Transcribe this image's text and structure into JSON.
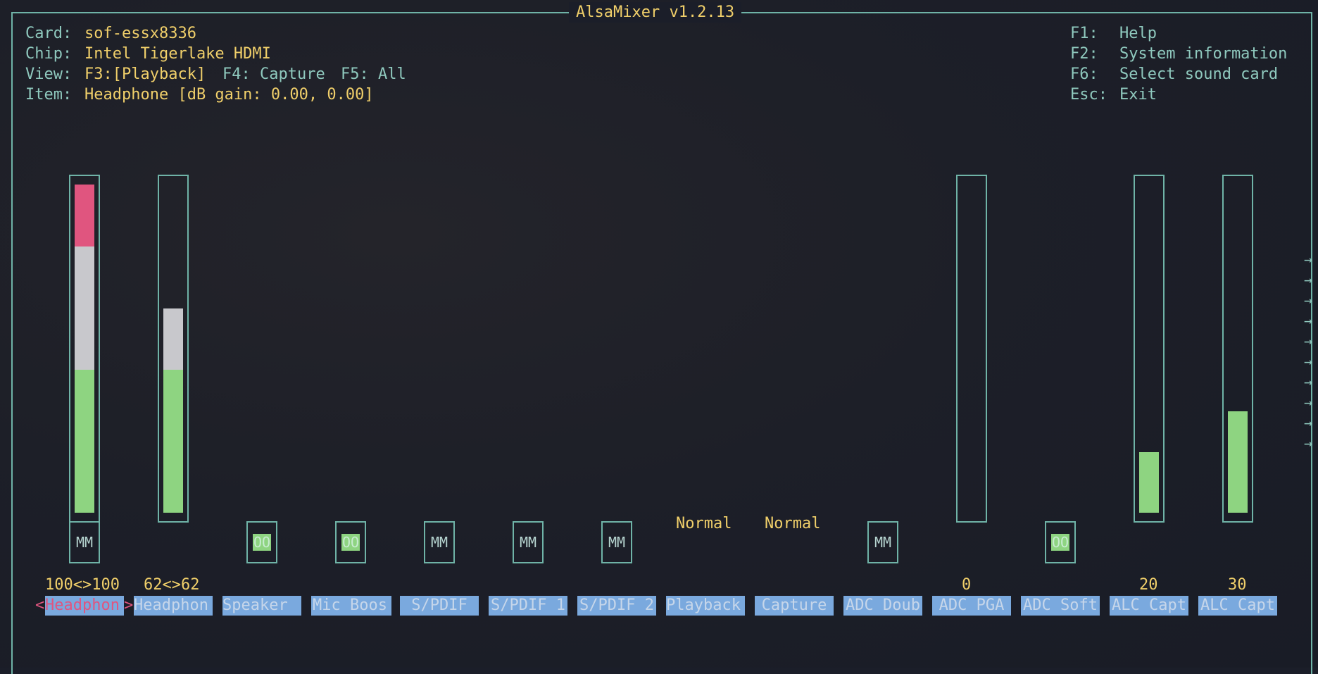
{
  "title": "AlsaMixer v1.2.13",
  "info": {
    "card_label": "Card:",
    "card": "sof-essx8336",
    "chip_label": "Chip:",
    "chip": "Intel Tigerlake HDMI",
    "view_label": "View:",
    "view_f3": "F3:[Playback]",
    "view_f4": "F4: Capture",
    "view_f5": "F5: All",
    "item_label": "Item:",
    "item": "Headphone [dB gain: 0.00, 0.00]"
  },
  "keys": [
    {
      "key": "F1:",
      "label": "Help"
    },
    {
      "key": "F2:",
      "label": "System information"
    },
    {
      "key": "F6:",
      "label": "Select sound card"
    },
    {
      "key": "Esc:",
      "label": "Exit"
    }
  ],
  "controls": [
    {
      "name": "Headphon",
      "value_text": "100<>100",
      "switch": "MM",
      "level": 100,
      "selected": true
    },
    {
      "name": "Headphon",
      "value_text": "62<>62",
      "level": 62
    },
    {
      "name": "Speaker",
      "switch": "OO"
    },
    {
      "name": "Mic Boos",
      "switch": "OO"
    },
    {
      "name": "S/PDIF",
      "switch": "MM"
    },
    {
      "name": "S/PDIF 1",
      "switch": "MM"
    },
    {
      "name": "S/PDIF 2",
      "switch": "MM"
    },
    {
      "name": "Playback",
      "enum_value": "Normal"
    },
    {
      "name": "Capture",
      "enum_value": "Normal"
    },
    {
      "name": "ADC Doub",
      "switch": "MM"
    },
    {
      "name": "ADC PGA",
      "value_text": "0",
      "level": 0
    },
    {
      "name": "ADC Soft",
      "switch": "OO"
    },
    {
      "name": "ALC Capt",
      "value_text": "20",
      "level": 20
    },
    {
      "name": "ALC Capt",
      "value_text": "30",
      "level": 30
    }
  ],
  "selection_markers": {
    "left": "<",
    "right": ">"
  },
  "more_arrow": "→",
  "colors": {
    "accent_yellow": "#f0cf6a",
    "border_teal": "#6fb3a7",
    "bar_green": "#8ed481",
    "bar_white": "#c8c8cc",
    "bar_red": "#e0557f",
    "label_blue": "#7aa9de"
  }
}
